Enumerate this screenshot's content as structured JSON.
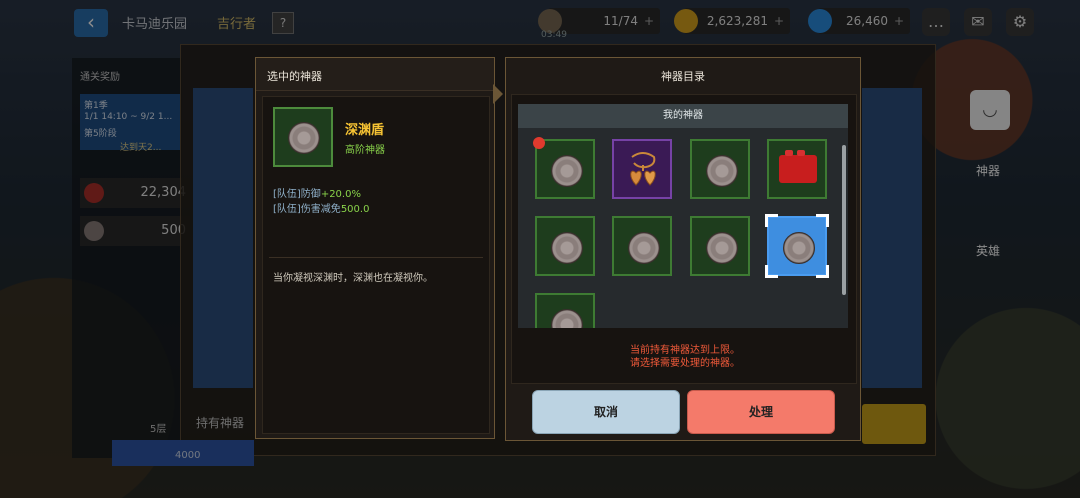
{
  "background": {
    "title": "卡马迪乐园",
    "subtitle": "吉行者",
    "help": "?",
    "resources": [
      {
        "value": "11/74",
        "sub": "03:49",
        "color": "#7a6a54"
      },
      {
        "value": "2,623,281",
        "color": "#d8a21e"
      },
      {
        "value": "26,460",
        "color": "#2a8de0"
      }
    ],
    "left": {
      "header": "通关奖励",
      "blue_lines": [
        "第1季",
        "1/1 14:10 ~ 9/2 1...",
        "第5阶段"
      ],
      "blue_note": "达到天2..."
    },
    "rows": [
      {
        "value": "22,304"
      },
      {
        "value": "500"
      }
    ],
    "hold_label": "持有神器",
    "level": "5层",
    "num": "4000",
    "side_labels": [
      "神器",
      "英雄"
    ]
  },
  "selected": {
    "title": "选中的神器",
    "name": "深渊盾",
    "grade": "高阶神器",
    "stats": [
      {
        "label": "[队伍]防御",
        "value": "+20.0%"
      },
      {
        "label": "[队伍]伤害减免",
        "value": "500.0"
      }
    ],
    "description": "当你凝视深渊时，深渊也在凝视你。"
  },
  "catalog": {
    "title": "神器目录",
    "tab": "我的神器",
    "warning_lines": [
      "当前持有神器达到上限。",
      "请选择需要处理的神器。"
    ],
    "cancel_label": "取消",
    "process_label": "处理"
  }
}
